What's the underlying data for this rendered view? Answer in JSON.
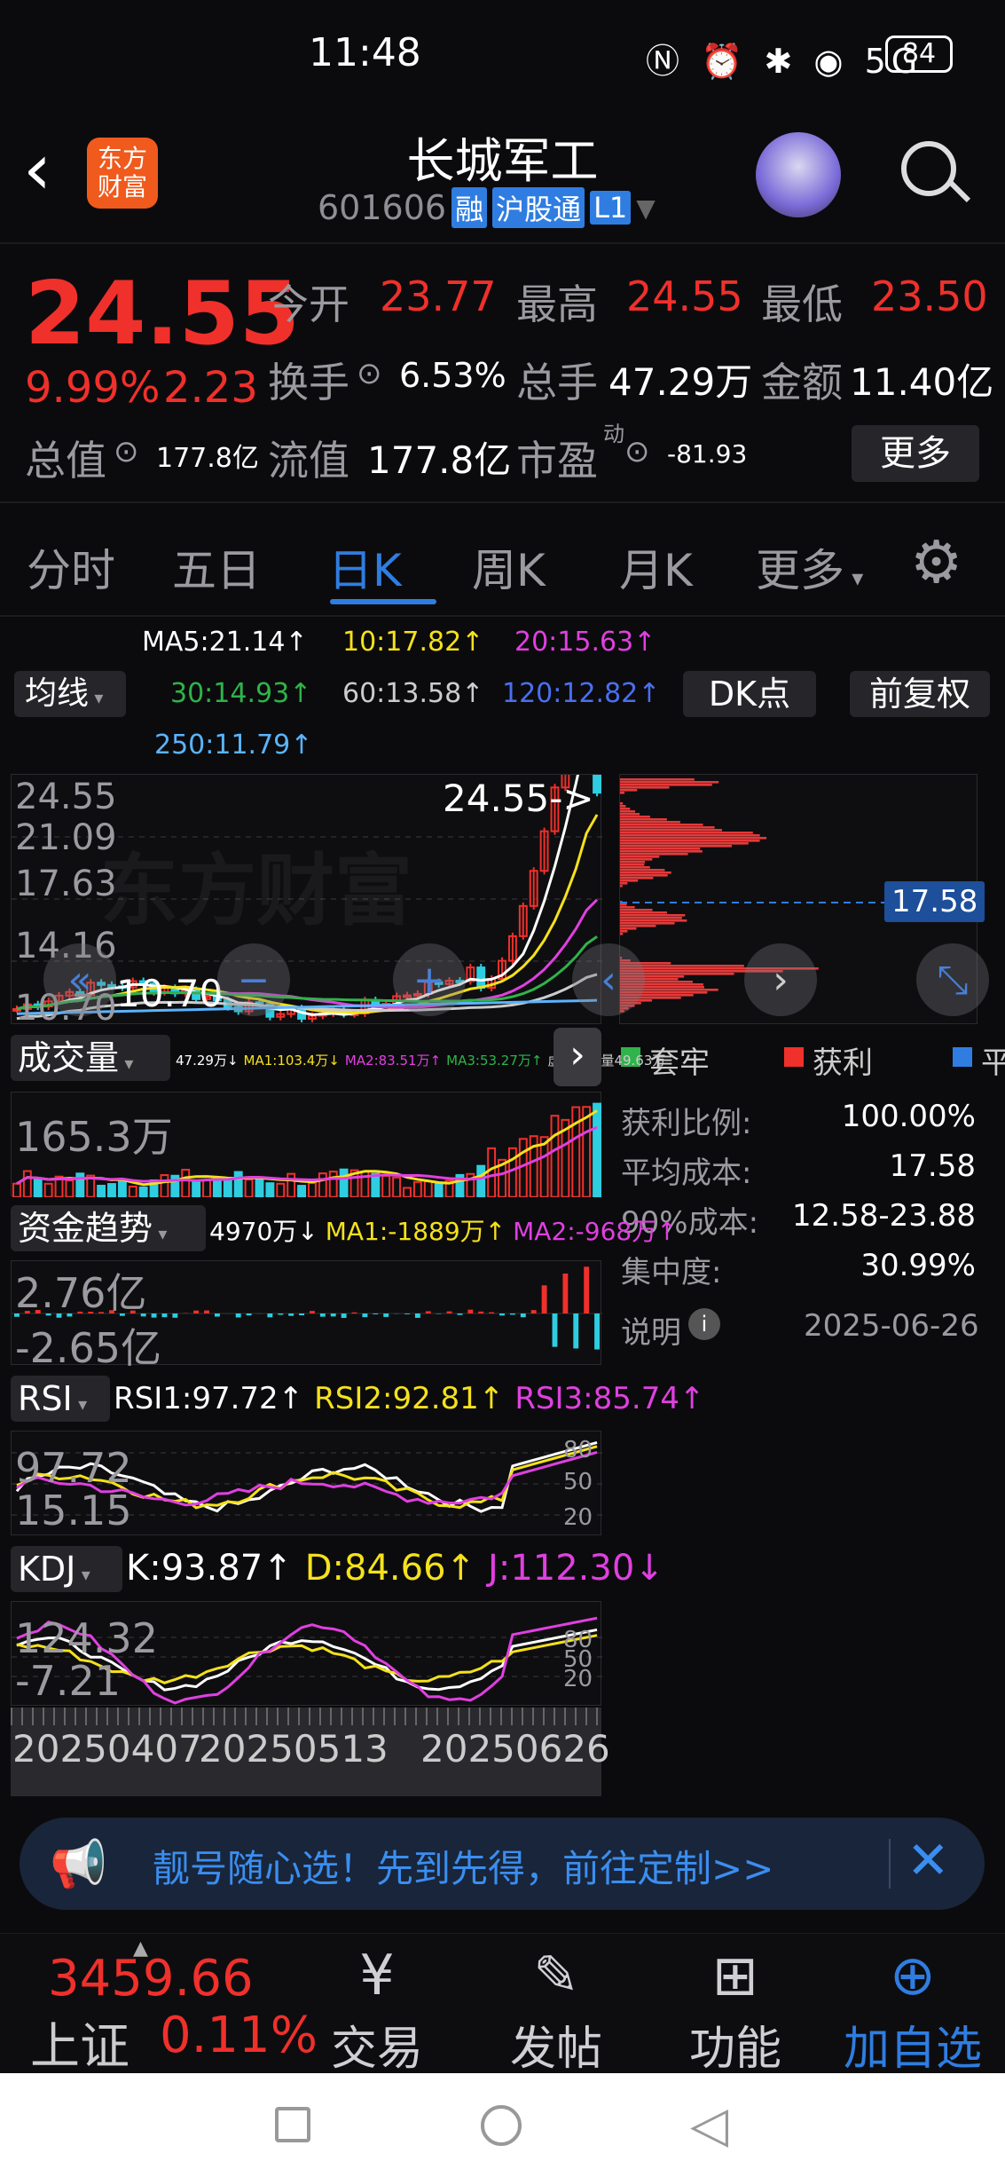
{
  "status": {
    "time": "11:48",
    "battery": "84"
  },
  "header": {
    "title": "长城军工",
    "code": "601606",
    "badges": [
      "融",
      "沪股通",
      "L1"
    ],
    "logo_line1": "东方",
    "logo_line2": "财富"
  },
  "quote": {
    "price": "24.55",
    "change_pct": "9.99%",
    "change": "2.23",
    "open_label": "今开",
    "open": "23.77",
    "high_label": "最高",
    "high": "24.55",
    "low_label": "最低",
    "low": "23.50",
    "turnover_label": "换手",
    "turnover": "6.53%",
    "volume_label": "总手",
    "volume": "47.29万",
    "amount_label": "金额",
    "amount": "11.40亿",
    "mktcap_label": "总值",
    "mktcap": "177.8亿",
    "float_label": "流值",
    "float": "177.8亿",
    "pe_label": "市盈",
    "pe_sup": "动",
    "pe": "-81.93",
    "more_label": "更多"
  },
  "tabs": {
    "items": [
      "分时",
      "五日",
      "日K",
      "周K",
      "月K",
      "更多"
    ],
    "active": "日K"
  },
  "ma": {
    "selector": "均线",
    "ma5": "MA5:21.14↑",
    "ma10": "10:17.82↑",
    "ma20": "20:15.63↑",
    "ma30": "30:14.93↑",
    "ma60": "60:13.58↑",
    "ma120": "120:12.82↑",
    "ma250": "250:11.79↑",
    "dk_label": "DK点",
    "adjust_label": "前复权"
  },
  "kchart": {
    "y_labels": [
      "24.55",
      "21.09",
      "17.63",
      "14.16",
      "10.70"
    ],
    "last_price_tag": "24.55->",
    "low_tag": "10.70",
    "watermark": "东方财富"
  },
  "volume": {
    "label": "成交量",
    "small_legend": [
      "47.29万↓",
      "MA1:103.4万↓",
      "MA2:83.51万↑",
      "MA3:53.27万↑",
      "虚拟成交量49.63万"
    ],
    "y_label": "165.3万"
  },
  "funds": {
    "label": "资金趋势",
    "value": "4970万↓",
    "ma1": "MA1:-1889万↑",
    "ma2": "MA2:-968万↑",
    "y_top": "2.76亿",
    "y_bottom": "-2.65亿"
  },
  "rsi": {
    "label": "RSI",
    "rsi1": "RSI1:97.72↑",
    "rsi2": "RSI2:92.81↑",
    "rsi3": "RSI3:85.74↑",
    "y_top": "97.72",
    "y_bottom": "15.15",
    "levels": [
      "80",
      "50",
      "20"
    ]
  },
  "kdj": {
    "label": "KDJ",
    "k": "K:93.87↑",
    "d": "D:84.66↑",
    "j": "J:112.30↓",
    "y_top": "124.32",
    "y_bottom": "-7.21",
    "levels": [
      "80",
      "50",
      "20"
    ]
  },
  "dates": [
    "20250407",
    "20250513",
    "20250626"
  ],
  "chip": {
    "legend": [
      "套牢",
      "获利",
      "平均"
    ],
    "avg_tag": "17.58",
    "rows": [
      {
        "label": "获利比例:",
        "value": "100.00%"
      },
      {
        "label": "平均成本:",
        "value": "17.58"
      },
      {
        "label": "90%成本:",
        "value": "12.58-23.88"
      },
      {
        "label": "集中度:",
        "value": "30.99%"
      }
    ],
    "note_label": "说明",
    "date": "2025-06-26"
  },
  "banner": {
    "text": "靓号随心选！先到先得，前往定制>>"
  },
  "toolbar": {
    "index_value": "3459.66",
    "index_name": "上证",
    "index_change": "0.11%",
    "items": [
      "交易",
      "发帖",
      "功能",
      "加自选"
    ]
  },
  "colors": {
    "up": "#f0302b",
    "down": "#2ecde0",
    "accent": "#2f7de1",
    "ma5": "#ffffff",
    "ma10": "#f5e11b",
    "ma20": "#e040e0",
    "ma30": "#2fb34a",
    "ma60": "#cccccc",
    "ma120": "#4a6ff0",
    "ma250": "#5ab4ff"
  }
}
